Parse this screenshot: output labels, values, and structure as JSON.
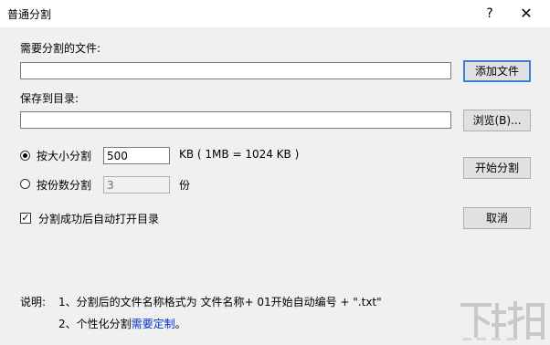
{
  "window": {
    "title": "普通分割",
    "help_glyph": "?",
    "close_glyph": "✕"
  },
  "source_file": {
    "label": "需要分割的文件:",
    "value": "",
    "add_button": "添加文件"
  },
  "output_dir": {
    "label": "保存到目录:",
    "value": "",
    "browse_button": "浏览(B)..."
  },
  "split_by_size": {
    "label": "按大小分割",
    "value": "500",
    "unit_note": "KB  ( 1MB = 1024 KB )",
    "selected": true
  },
  "split_by_count": {
    "label": "按份数分割",
    "value": "3",
    "unit": "份",
    "selected": false
  },
  "auto_open": {
    "label": "分割成功后自动打开目录",
    "checked": true,
    "check_glyph": "✓"
  },
  "buttons": {
    "start": "开始分割",
    "cancel": "取消"
  },
  "notes": {
    "heading": "说明:",
    "line1": "1、分割后的文件名称格式为   文件名称+ 01开始自动编号 + \".txt\"",
    "line2_prefix": "2、个性化分割",
    "line2_link": "需要定制",
    "line2_suffix": "。"
  },
  "watermark": "下载吧"
}
